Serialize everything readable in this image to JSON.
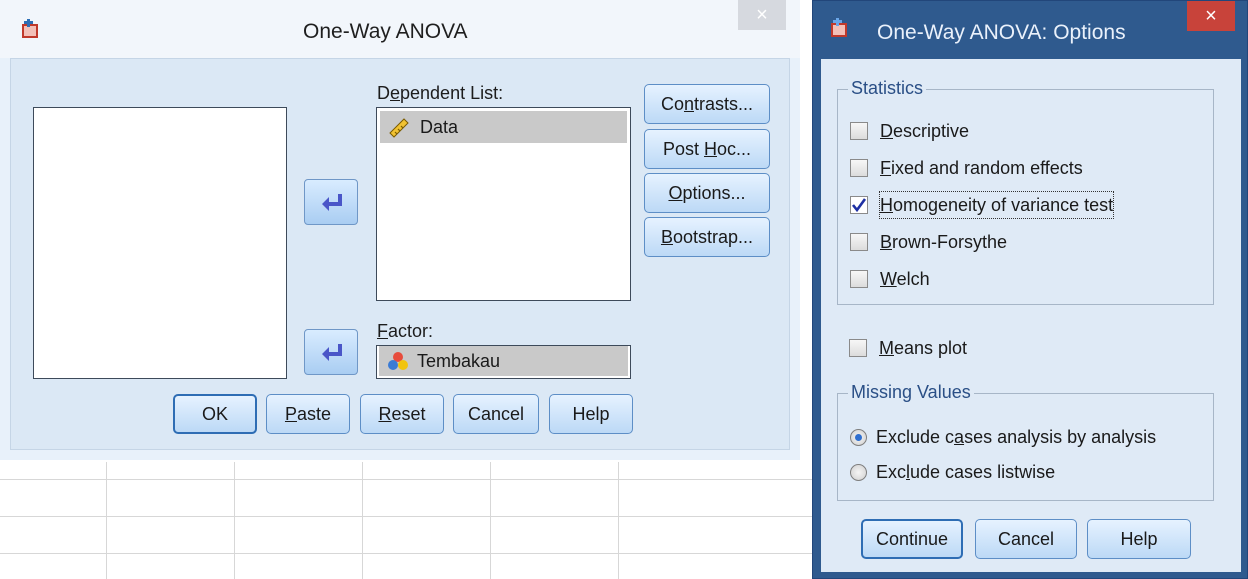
{
  "main_dialog": {
    "title": "One-Way ANOVA",
    "close_glyph": "×",
    "source_list": [],
    "dependent_list": {
      "label_pre": "D",
      "label_u": "e",
      "label_post": "pendent List:",
      "items": [
        {
          "label": "Data",
          "icon": "scale-ruler-icon"
        }
      ]
    },
    "factor": {
      "label_pre": "",
      "label_u": "F",
      "label_post": "actor:",
      "value": "Tembakau",
      "icon": "nominal-variable-icon"
    },
    "side_buttons": [
      {
        "pre": "Co",
        "u": "n",
        "post": "trasts..."
      },
      {
        "pre": "Post ",
        "u": "H",
        "post": "oc..."
      },
      {
        "pre": "",
        "u": "O",
        "post": "ptions..."
      },
      {
        "pre": "",
        "u": "B",
        "post": "ootstrap..."
      }
    ],
    "bottom_buttons": [
      {
        "pre": "OK",
        "u": "",
        "post": ""
      },
      {
        "pre": "",
        "u": "P",
        "post": "aste"
      },
      {
        "pre": "",
        "u": "R",
        "post": "eset"
      },
      {
        "pre": "Cancel",
        "u": "",
        "post": ""
      },
      {
        "pre": "Help",
        "u": "",
        "post": ""
      }
    ]
  },
  "options_dialog": {
    "title": "One-Way ANOVA: Options",
    "close_glyph": "×",
    "statistics": {
      "title": "Statistics",
      "items": [
        {
          "pre": "",
          "u": "D",
          "post": "escriptive",
          "checked": false
        },
        {
          "pre": "",
          "u": "F",
          "post": "ixed and random effects",
          "checked": false
        },
        {
          "pre": "",
          "u": "H",
          "post": "omogeneity of variance test",
          "checked": true
        },
        {
          "pre": "",
          "u": "B",
          "post": "rown-Forsythe",
          "checked": false
        },
        {
          "pre": "",
          "u": "W",
          "post": "elch",
          "checked": false
        }
      ]
    },
    "means_plot": {
      "pre": "",
      "u": "M",
      "post": "eans plot",
      "checked": false
    },
    "missing_values": {
      "title": "Missing Values",
      "options": [
        {
          "pre": "Exclude c",
          "u": "a",
          "post": "ses analysis by analysis",
          "selected": true
        },
        {
          "pre": "Exc",
          "u": "l",
          "post": "ude cases listwise",
          "selected": false
        }
      ]
    },
    "buttons": [
      {
        "label": "Continue"
      },
      {
        "label": "Cancel"
      },
      {
        "label": "Help"
      }
    ]
  },
  "colors": {
    "dialog_bg": "#dbe8f5",
    "options_frame": "#2f5a8e",
    "button_gradient_top": "#e6f2ff",
    "button_gradient_bottom": "#bcd9f6",
    "close_red": "#c8433a",
    "group_title": "#2a4f86"
  }
}
